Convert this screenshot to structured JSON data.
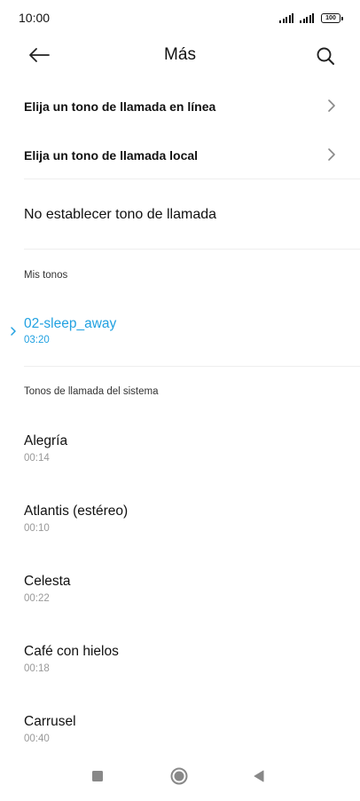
{
  "status_bar": {
    "time": "10:00",
    "battery": "100"
  },
  "header": {
    "title": "Más"
  },
  "options": {
    "online_label": "Elija un tono de llamada en línea",
    "local_label": "Elija un tono de llamada local",
    "none_label": "No establecer tono de llamada"
  },
  "my_tones": {
    "section_label": "Mis tonos",
    "items": [
      {
        "name": "02-sleep_away",
        "duration": "03:20",
        "selected": true
      }
    ]
  },
  "system_tones": {
    "section_label": "Tonos de llamada del sistema",
    "items": [
      {
        "name": "Alegría",
        "duration": "00:14"
      },
      {
        "name": "Atlantis (estéreo)",
        "duration": "00:10"
      },
      {
        "name": "Celesta",
        "duration": "00:22"
      },
      {
        "name": "Café con hielos",
        "duration": "00:18"
      },
      {
        "name": "Carrusel",
        "duration": "00:40"
      }
    ]
  },
  "colors": {
    "accent": "#21a1e1",
    "text": "#111111",
    "secondary_text": "#999999",
    "divider": "#eeeeee"
  },
  "icons": {
    "back": "back-arrow-icon",
    "search": "search-icon",
    "chevron": "chevron-right-icon",
    "selected": "selected-indicator-icon",
    "nav_recents": "square-icon",
    "nav_home": "circle-icon",
    "nav_back": "triangle-back-icon"
  }
}
